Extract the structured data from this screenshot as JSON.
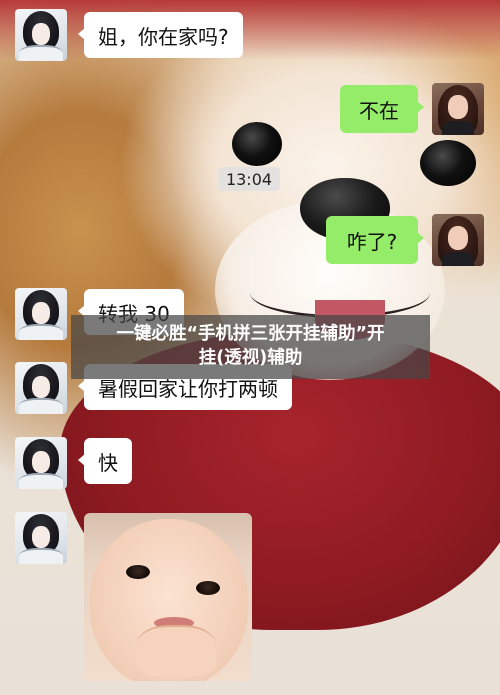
{
  "messages": [
    {
      "side": "in",
      "text": "姐，你在家吗?"
    },
    {
      "side": "out",
      "text": "不在"
    },
    {
      "side": "out",
      "text": "咋了?"
    },
    {
      "side": "in",
      "text": "转我 30"
    },
    {
      "side": "in",
      "text": "暑假回家让你打两顿"
    },
    {
      "side": "in",
      "text": "快"
    }
  ],
  "timestamp": "13:04",
  "banner": {
    "line1": "一键必胜“手机拼三张开挂辅助”开",
    "line2": "挂(透视)辅助"
  },
  "colors": {
    "bubble_in": "#ffffff",
    "bubble_out": "#95ec69",
    "banner_bg": "#464646"
  },
  "icons": {
    "sender_avatar": "ink-painting-man-avatar",
    "self_avatar": "woman-portrait-avatar",
    "sticker": "baby-sticker",
    "background": "shiba-dog-photo"
  }
}
